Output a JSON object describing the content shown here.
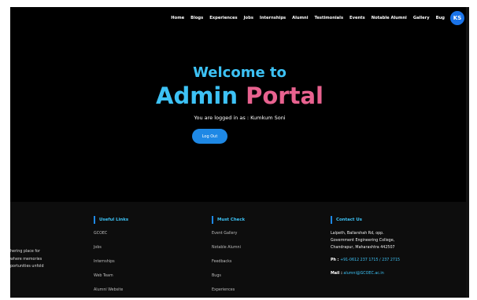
{
  "nav": {
    "items": [
      "Home",
      "Blogs",
      "Experiences",
      "Jobs",
      "Internships",
      "Alumni",
      "Testimonials",
      "Events",
      "Notable Alumni",
      "Gallery",
      "Bug"
    ],
    "avatar_initials": "KS"
  },
  "hero": {
    "welcome": "Welcome to",
    "title_part1": "Admin",
    "title_part2": "Portal",
    "logged_in_text": "You are logged in as : Kumkum Soni",
    "logout_label": "Log Out"
  },
  "footer": {
    "tagline": [
      "hering place for",
      "where memories",
      "portunities unfold"
    ],
    "useful_links": {
      "heading": "Useful Links",
      "items": [
        "GCOEC",
        "Jobs",
        "Internships",
        "Web Team",
        "Alumni Website"
      ]
    },
    "must_check": {
      "heading": "Must Check",
      "items": [
        "Event Gallery",
        "Notable Alumni",
        "Feedbacks",
        "Bugs",
        "Experiences"
      ]
    },
    "contact": {
      "heading": "Contact Us",
      "address": [
        "Lalpeth, Ballarshah Rd, opp.",
        "Government Engineering College,",
        "Chandrapur, Maharashtra 442507"
      ],
      "phone_label": "Ph :",
      "phone": "+91-0612 237 1715 / 237 2715",
      "mail_label": "Mail :",
      "mail": "alumni@GCOEC.ac.in"
    }
  },
  "colors": {
    "accent_blue": "#3dc2f5",
    "accent_pink": "#e8628f",
    "button_blue": "#1e88e5"
  }
}
